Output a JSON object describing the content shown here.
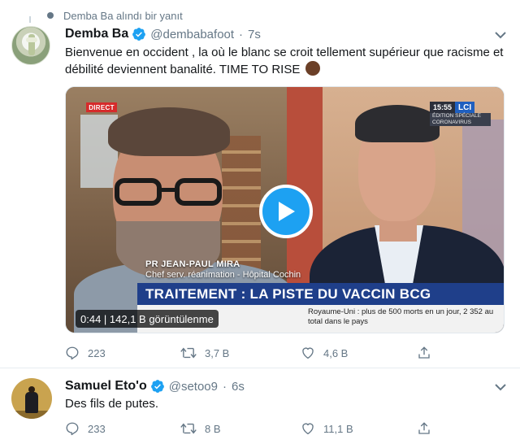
{
  "retweet_context": {
    "text": "Demba Ba alındı bir yanıt"
  },
  "tweet1": {
    "name": "Demba Ba",
    "handle": "@dembabafoot",
    "separator": "·",
    "time": "7s",
    "text": "Bienvenue en occident , la où le blanc se croit tellement supérieur que racisme et débilité deviennent banalité. TIME TO RISE",
    "emoji_icon": "raised-fist-dark-skin-tone",
    "video": {
      "badge": "DIRECT",
      "clock": "15:55",
      "channel": "LCI",
      "channel_subtitle": "ÉDITION SPÉCIALE CORONAVIRUS",
      "lower_name": "PR JEAN-PAUL MIRA",
      "lower_title": "Chef serv. réanimation - Hôpital Cochin",
      "headline": "TRAITEMENT : LA PISTE DU VACCIN BCG",
      "ticker": "Royaume-Uni : plus de 500 morts en un jour, 2 352 au total dans le pays",
      "stats": "0:44 | 142,1 B görüntülenme"
    },
    "actions": {
      "replies": "223",
      "retweets": "3,7 B",
      "likes": "4,6 B"
    }
  },
  "tweet2": {
    "name": "Samuel Eto'o",
    "handle": "@setoo9",
    "separator": "·",
    "time": "6s",
    "text": "Des fils de putes.",
    "actions": {
      "replies": "233",
      "retweets": "8 B",
      "likes": "11,1 B"
    }
  },
  "colors": {
    "verified_blue": "#1da1f2",
    "secondary_text": "#657786",
    "lci_blue": "#1f5fbf",
    "headline_blue": "#1f3f8a"
  }
}
